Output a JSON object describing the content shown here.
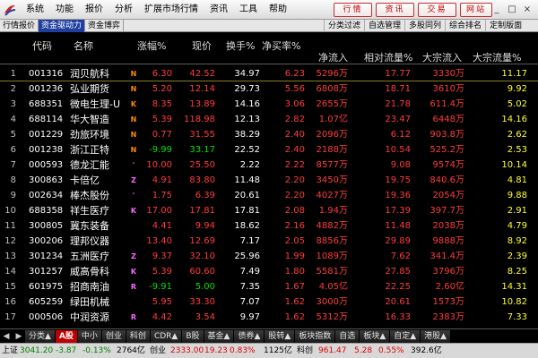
{
  "menubar": {
    "items": [
      "系统",
      "功能",
      "报价",
      "分析",
      "扩展市场行情",
      "资讯",
      "工具",
      "帮助"
    ],
    "right_buttons": [
      "行情",
      "资讯",
      "交易",
      "网站"
    ],
    "window_controls": [
      "_",
      "□",
      "×"
    ]
  },
  "tabbar": {
    "left_tabs": [
      "行情报价",
      "资金驱动力",
      "资金博弈"
    ],
    "active_left": 1,
    "right_tabs": [
      "分类过滤",
      "自选管理",
      "多股同列",
      "综合排名",
      "定制版面"
    ]
  },
  "table": {
    "headers": {
      "code": "代码",
      "name": "名称",
      "chg": "涨幅%",
      "price": "现价",
      "turn": "换手%",
      "buy": "净买率%",
      "net": "净流入",
      "rel": "相对流量%",
      "bn": "大宗流入",
      "bf": "大宗流量%"
    },
    "rows": [
      {
        "idx": "1",
        "code": "001316",
        "name": "润贝航科",
        "mark": "N",
        "mark_color": "#ff8c00",
        "chg": "6.30",
        "price": "42.52",
        "turn": "34.97",
        "buy": "6.23",
        "net": "5296万",
        "rel": "17.77",
        "bn": "3330万",
        "bf": "11.17",
        "price_c": "red"
      },
      {
        "idx": "2",
        "code": "001236",
        "name": "弘业期货",
        "mark": "N",
        "mark_color": "#ff8c00",
        "chg": "5.20",
        "price": "12.14",
        "turn": "29.73",
        "buy": "5.56",
        "net": "6808万",
        "rel": "18.71",
        "bn": "3610万",
        "bf": "9.92",
        "price_c": "red"
      },
      {
        "idx": "3",
        "code": "688351",
        "name": "微电生理-U",
        "mark": "K",
        "mark_color": "#ff8c00",
        "chg": "8.35",
        "price": "13.89",
        "turn": "14.16",
        "buy": "3.06",
        "net": "2655万",
        "rel": "21.78",
        "bn": "611.4万",
        "bf": "5.02",
        "price_c": "red"
      },
      {
        "idx": "4",
        "code": "688114",
        "name": "华大智造",
        "mark": "N",
        "mark_color": "#ff8c00",
        "chg": "5.39",
        "price": "118.98",
        "turn": "12.13",
        "buy": "2.82",
        "net": "1.07亿",
        "rel": "23.47",
        "bn": "6448万",
        "bf": "14.16",
        "price_c": "red"
      },
      {
        "idx": "5",
        "code": "001229",
        "name": "劲旅环境",
        "mark": "N",
        "mark_color": "#ff8c00",
        "chg": "0.77",
        "price": "31.55",
        "turn": "38.29",
        "buy": "2.40",
        "net": "2096万",
        "rel": "6.12",
        "bn": "903.8万",
        "bf": "2.62",
        "price_c": "red"
      },
      {
        "idx": "6",
        "code": "001238",
        "name": "浙江正特",
        "mark": "N",
        "mark_color": "#ff8c00",
        "chg": "-9.99",
        "price": "33.17",
        "turn": "22.52",
        "buy": "2.40",
        "net": "2188万",
        "rel": "10.54",
        "bn": "525.2万",
        "bf": "2.53",
        "price_c": "green"
      },
      {
        "idx": "7",
        "code": "000593",
        "name": "德龙汇能",
        "mark": "'",
        "mark_color": "#ff8c00",
        "chg": "10.00",
        "price": "25.50",
        "turn": "2.22",
        "buy": "2.22",
        "net": "8577万",
        "rel": "9.08",
        "bn": "9574万",
        "bf": "10.14",
        "price_c": "red"
      },
      {
        "idx": "8",
        "code": "300863",
        "name": "卡倍亿",
        "mark": "Z",
        "mark_color": "#ff66ff",
        "chg": "4.91",
        "price": "83.80",
        "turn": "11.48",
        "buy": "2.20",
        "net": "3450万",
        "rel": "19.75",
        "bn": "840.6万",
        "bf": "4.81",
        "price_c": "red"
      },
      {
        "idx": "9",
        "code": "002634",
        "name": "棒杰股份",
        "mark": "'",
        "mark_color": "#ff66ff",
        "chg": "1.75",
        "price": "6.39",
        "turn": "20.61",
        "buy": "2.20",
        "net": "4027万",
        "rel": "19.36",
        "bn": "2054万",
        "bf": "9.88",
        "price_c": "red"
      },
      {
        "idx": "10",
        "code": "688358",
        "name": "祥生医疗",
        "mark": "K",
        "mark_color": "#ff66ff",
        "chg": "17.00",
        "price": "17.81",
        "turn": "17.81",
        "buy": "2.08",
        "net": "1.94万",
        "rel": "17.39",
        "bn": "397.7万",
        "bf": "2.91",
        "price_c": "red"
      },
      {
        "idx": "11",
        "code": "300805",
        "name": "冀东装备",
        "mark": "",
        "mark_color": "#ff8c00",
        "chg": "4.41",
        "price": "9.94",
        "turn": "18.62",
        "buy": "2.16",
        "net": "4882万",
        "rel": "11.48",
        "bn": "2038万",
        "bf": "4.79",
        "price_c": "red"
      },
      {
        "idx": "12",
        "code": "300206",
        "name": "理邦仪器",
        "mark": "",
        "mark_color": "#ff8c00",
        "chg": "13.40",
        "price": "12.69",
        "turn": "7.17",
        "buy": "2.05",
        "net": "8856万",
        "rel": "29.89",
        "bn": "9888万",
        "bf": "8.92",
        "price_c": "red"
      },
      {
        "idx": "13",
        "code": "301234",
        "name": "五洲医疗",
        "mark": "Z",
        "mark_color": "#ff66ff",
        "chg": "9.37",
        "price": "32.10",
        "turn": "25.96",
        "buy": "1.99",
        "net": "1089万",
        "rel": "7.62",
        "bn": "341.4万",
        "bf": "2.39",
        "price_c": "red"
      },
      {
        "idx": "14",
        "code": "301257",
        "name": "威高骨科",
        "mark": "K",
        "mark_color": "#ff66ff",
        "chg": "5.39",
        "price": "60.60",
        "turn": "7.49",
        "buy": "1.80",
        "net": "5581万",
        "rel": "27.85",
        "bn": "3796万",
        "bf": "8.25",
        "price_c": "red"
      },
      {
        "idx": "15",
        "code": "601975",
        "name": "招商南油",
        "mark": "R",
        "mark_color": "#ff66ff",
        "chg": "-9.91",
        "price": "5.00",
        "turn": "7.35",
        "buy": "1.67",
        "net": "4.05亿",
        "rel": "22.25",
        "bn": "2.60亿",
        "bf": "14.31",
        "price_c": "green"
      },
      {
        "idx": "16",
        "code": "605259",
        "name": "绿田机械",
        "mark": "",
        "mark_color": "#ff8c00",
        "chg": "5.95",
        "price": "33.30",
        "turn": "7.07",
        "buy": "1.62",
        "net": "3000万",
        "rel": "20.61",
        "bn": "1573万",
        "bf": "10.82",
        "price_c": "red"
      },
      {
        "idx": "17",
        "code": "000506",
        "name": "中润资源",
        "mark": "R",
        "mark_color": "#ff66ff",
        "chg": "4.42",
        "price": "3.54",
        "turn": "9.97",
        "buy": "1.62",
        "net": "5312万",
        "rel": "16.33",
        "bn": "2383万",
        "bf": "7.33",
        "price_c": "red"
      }
    ]
  },
  "bottom_tabs": {
    "items": [
      "分类▲",
      "A股",
      "中小",
      "创业",
      "科创",
      "CDR▲",
      "B股",
      "基金▲",
      "债券▲",
      "股转▲",
      "板块指数",
      "自选",
      "板块▲",
      "自定▲",
      "港股▲"
    ],
    "active": 1,
    "nav": [
      "◀",
      "▶"
    ]
  },
  "status": {
    "sh_label": "上证",
    "sh_val": "3041.20",
    "sh_chg": "-3.87",
    "sh_pct": "-0.13%",
    "sh_amt": "2764亿",
    "cy_label": "创业",
    "cy_val": "2333.00",
    "cy_chg": "19.23",
    "cy_pct": "0.83%",
    "cy_amt": "1125亿",
    "kc_label": "科创",
    "kc_val": "961.47",
    "kc_chg": "5.28",
    "kc_pct": "0.55%",
    "kc_amt": "392.6亿"
  }
}
